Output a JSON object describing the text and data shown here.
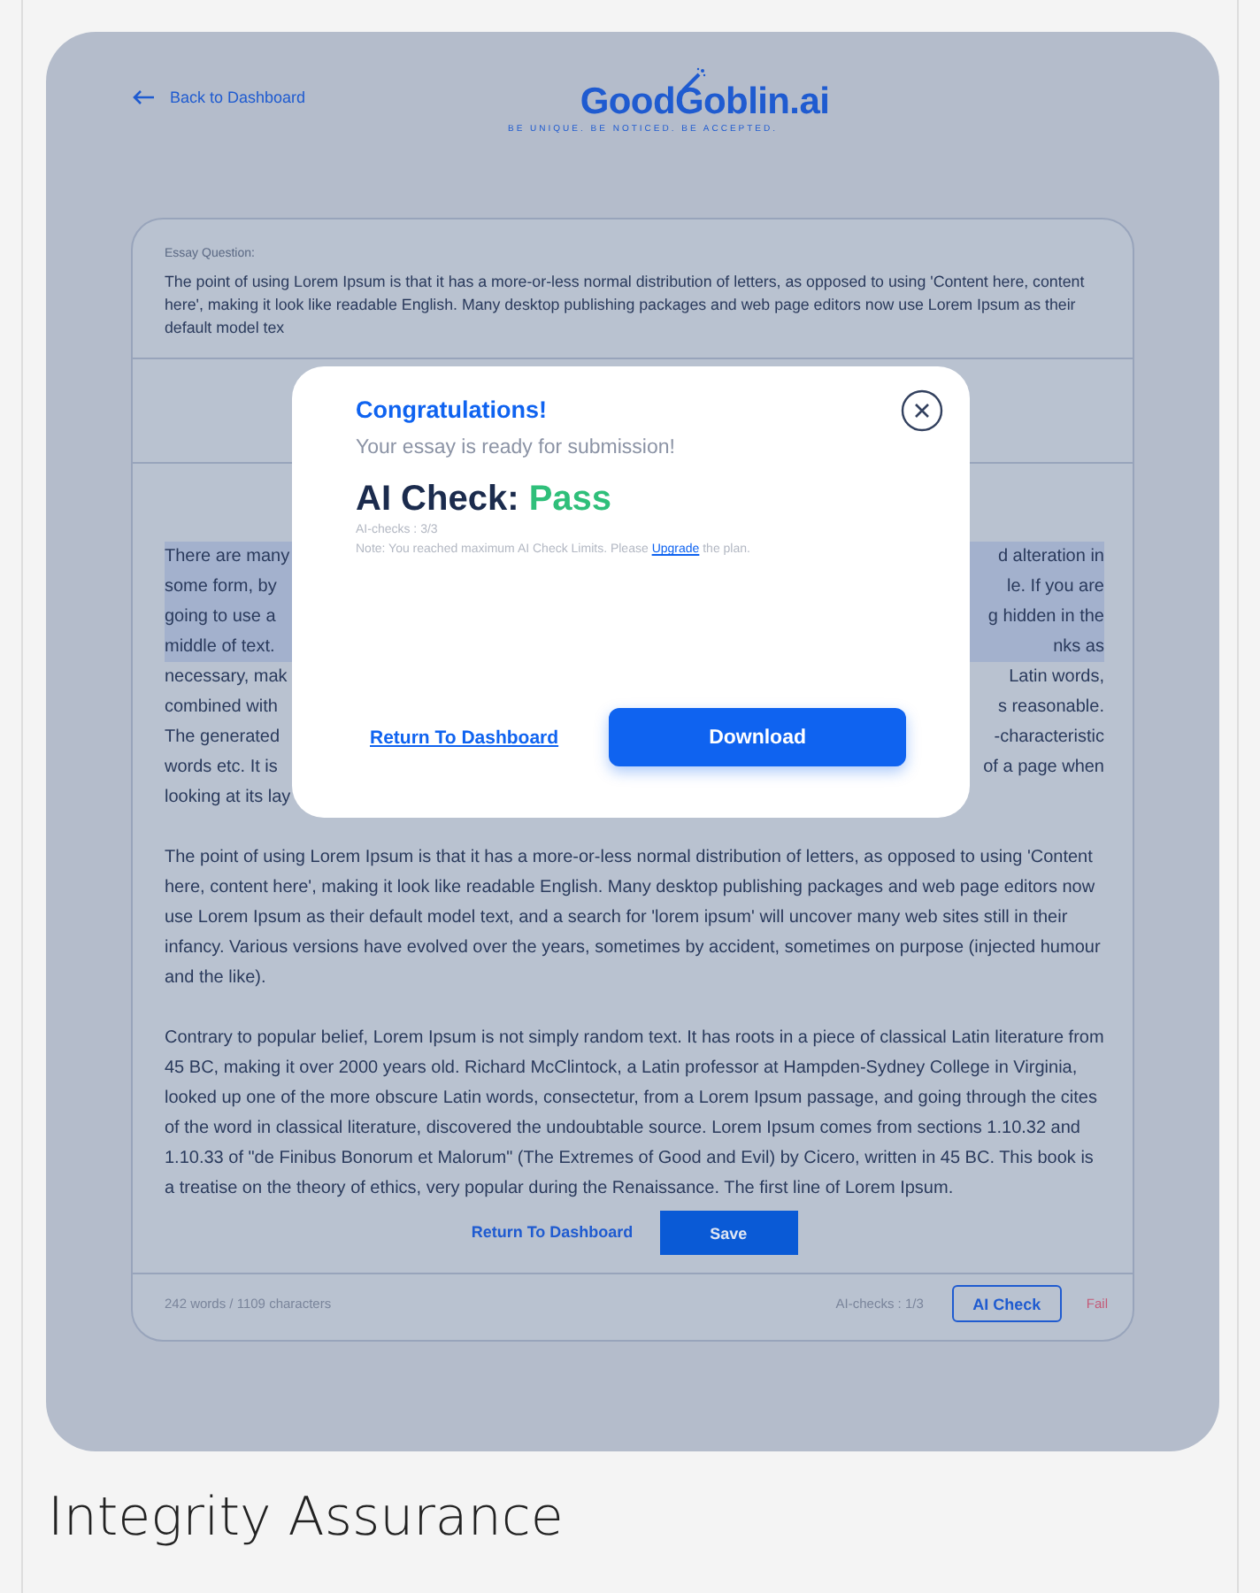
{
  "header": {
    "back_link": "Back to Dashboard",
    "logo": "GoodGoblin.ai",
    "tagline": "BE UNIQUE. BE NOTICED. BE ACCEPTED."
  },
  "essay_question": {
    "label": "Essay Question:",
    "text": "The point of using Lorem Ipsum is that it has a more-or-less normal distribution of letters, as opposed to using 'Content here, content here', making it look like readable English. Many desktop publishing packages and web page editors now use Lorem Ipsum as their default model tex"
  },
  "covered_paragraph": [
    {
      "left": "There are many",
      "right": "d alteration in",
      "highlighted": true
    },
    {
      "left": "some form, by",
      "right": "le. If you are",
      "highlighted": true
    },
    {
      "left": "going to use a",
      "right": "g hidden in the",
      "highlighted": true
    },
    {
      "left": "middle of text.",
      "right": "nks as",
      "highlighted": true
    },
    {
      "left": "necessary, mak",
      "right": "Latin words,",
      "highlighted": false
    },
    {
      "left": "combined with",
      "right": "s reasonable.",
      "highlighted": false
    },
    {
      "left": "The generated",
      "right": "-characteristic",
      "highlighted": false
    },
    {
      "left": "words etc. It is",
      "right": "of a page when",
      "highlighted": false
    },
    {
      "left": "looking at its lay",
      "highlighted": false
    }
  ],
  "paragraphs": [
    "The point of using Lorem Ipsum is that it has a more-or-less normal distribution of letters, as opposed to using 'Content here, content here', making it look like readable English. Many desktop publishing packages and web page editors now use Lorem Ipsum as their default model text, and a search for 'lorem ipsum' will uncover many web sites still in their infancy. Various versions have evolved over the years, sometimes by accident, sometimes on purpose (injected humour and the like).",
    "Contrary to popular belief, Lorem Ipsum is not simply random text. It has roots in a piece of classical Latin literature from 45 BC, making it over 2000 years old. Richard McClintock, a Latin professor at Hampden-Sydney College in Virginia, looked up one of the more obscure Latin words, consectetur, from a Lorem Ipsum passage, and going through the cites of the word in classical literature, discovered the undoubtable source. Lorem Ipsum comes from sections 1.10.32 and 1.10.33 of \"de Finibus Bonorum et Malorum\" (The Extremes of Good and Evil) by Cicero, written in 45 BC. This book is a treatise on the theory of ethics, very popular during the Renaissance. The first line of Lorem Ipsum."
  ],
  "editor_actions": {
    "return_link": "Return To Dashboard",
    "save_button": "Save"
  },
  "footer": {
    "counts": "242 words / 1109 characters",
    "checks": "AI-checks : 1/3",
    "check_button": "AI Check",
    "result": "Fail"
  },
  "modal": {
    "title": "Congratulations!",
    "subtitle": "Your essay is ready for submission!",
    "check_label": "AI Check: ",
    "check_result": "Pass",
    "checks": "AI-checks : 3/3",
    "note": "Note: You reached maximum AI Check Limits. Please ",
    "note_link": "Upgrade",
    "note_end": " the plan.",
    "return_link": "Return To Dashboard",
    "download_button": "Download"
  },
  "caption": "Integrity Assurance"
}
